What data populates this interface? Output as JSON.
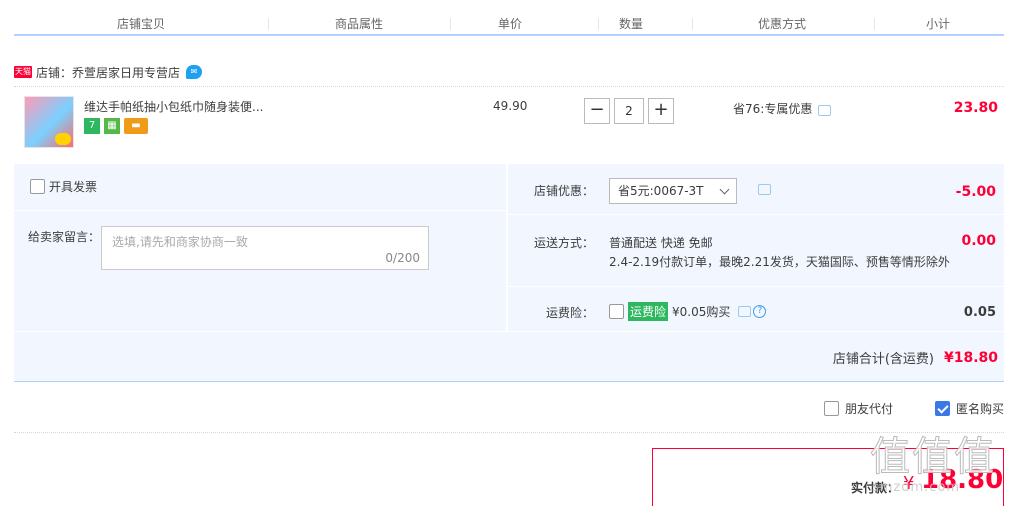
{
  "header": {
    "col_shop_item": "店铺宝贝",
    "col_attrs": "商品属性",
    "col_price": "单价",
    "col_qty": "数量",
    "col_discount": "优惠方式",
    "col_subtotal": "小计"
  },
  "shop": {
    "badge": "天猫",
    "name": "店铺：乔萱居家日用专营店",
    "chat_icon": "chat-bubble-icon"
  },
  "item": {
    "title": "维达手帕纸抽小包纸巾随身装便...",
    "badge_7": "7",
    "price": "49.90",
    "qty": "2",
    "minus": "−",
    "plus": "+",
    "discount": "省76:专属优惠",
    "subtotal": "23.80"
  },
  "invoice": {
    "label": "开具发票"
  },
  "memo": {
    "label": "给卖家留言：",
    "placeholder": "选填,请先和商家协商一致",
    "count": "0/200"
  },
  "shop_discount": {
    "label": "店铺优惠：",
    "selected": "省5元:0067-3T",
    "value": "-5.00"
  },
  "shipping": {
    "label": "运送方式：",
    "method": "普通配送 快递 免邮",
    "note": "2.4-2.19付款订单，最晚2.21发货，天猫国际、预售等情形除外",
    "value": "0.00"
  },
  "insurance": {
    "label": "运费险：",
    "badge": "运费险",
    "text": "¥0.05购买",
    "value": "0.05"
  },
  "total": {
    "label": "店铺合计(含运费)",
    "amount": "¥18.80"
  },
  "options": {
    "friend_pay": "朋友代付",
    "anonymous": "匿名购买",
    "anonymous_checked": true
  },
  "payment": {
    "label": "实付款：",
    "currency": "¥",
    "amount": "18.80"
  },
  "watermark": {
    "logo": "值值值",
    "site": "smzdm.com"
  },
  "colors": {
    "accent_red": "#ff0036",
    "header_line": "#b2d1ff",
    "panel_bg": "#f2f7ff"
  }
}
